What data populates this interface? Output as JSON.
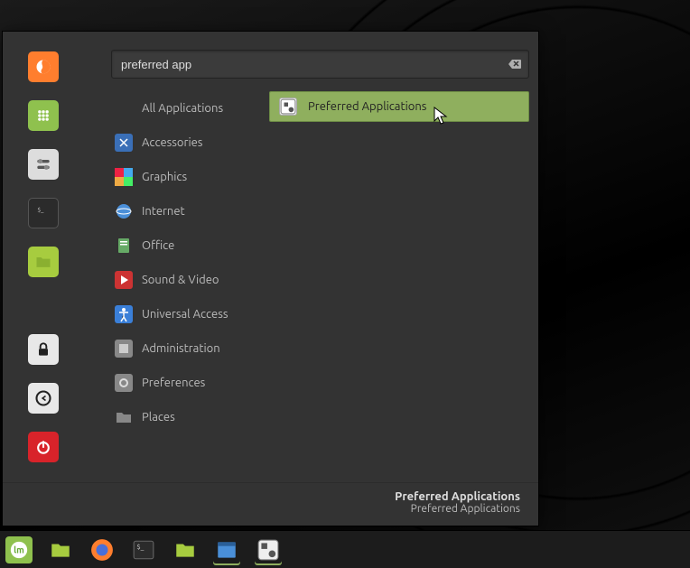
{
  "search": {
    "value": "preferred app"
  },
  "categories": [
    "All Applications",
    "Accessories",
    "Graphics",
    "Internet",
    "Office",
    "Sound & Video",
    "Universal Access",
    "Administration",
    "Preferences",
    "Places"
  ],
  "results": [
    {
      "label": "Preferred Applications"
    }
  ],
  "footer": {
    "title": "Preferred Applications",
    "desc": "Preferred Applications"
  },
  "favorites": {
    "firefox": "Firefox",
    "apps": "Software Manager",
    "settings": "Settings",
    "terminal": "Terminal",
    "files": "Files",
    "lock": "Lock Screen",
    "logout": "Logout",
    "power": "Quit"
  },
  "taskbar": {
    "menu": "Menu",
    "files": "Files",
    "firefox": "Firefox",
    "terminal": "Terminal",
    "files2": "Files",
    "app1": "Application",
    "prefs": "Preferred Applications"
  }
}
